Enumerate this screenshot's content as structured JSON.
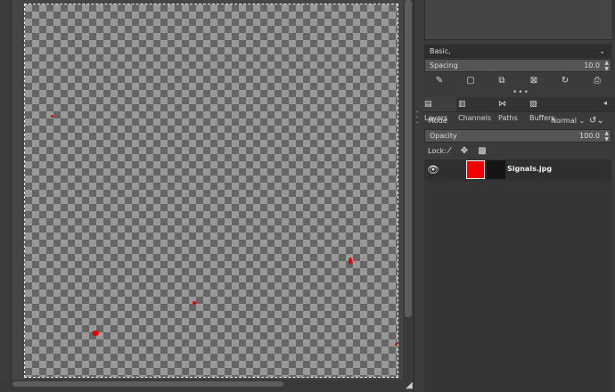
{
  "canvas": {},
  "tool_options": {
    "preset_label": "Basic,",
    "spacing_label": "Spacing",
    "spacing_value": "10.0"
  },
  "tabs": [
    {
      "label": "Layers",
      "icon": "layers-icon"
    },
    {
      "label": "Channels",
      "icon": "channels-icon"
    },
    {
      "label": "Paths",
      "icon": "paths-icon"
    },
    {
      "label": "Buffers",
      "icon": "buffers-icon"
    }
  ],
  "layers_panel": {
    "mode_label": "Mode",
    "mode_value": "Normal",
    "opacity_label": "Opacity",
    "opacity_value": "100.0",
    "lock_label": "Lock:",
    "layers": [
      {
        "name": "Signals.jpg",
        "visible": true,
        "thumb_color": "#f20000"
      }
    ]
  },
  "colors": {
    "panel_bg": "#3b3b3b",
    "field_bg": "#555555",
    "layer_selected_bg": "#2f2f2f",
    "accent_red": "#e00000"
  }
}
